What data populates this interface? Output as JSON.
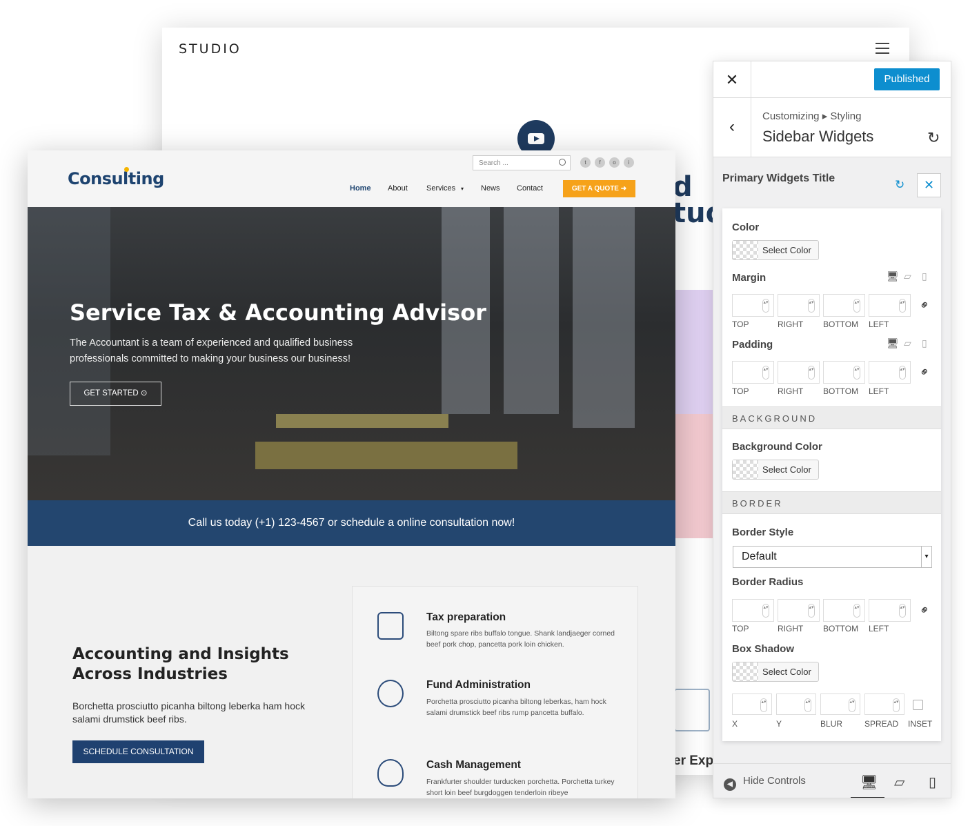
{
  "studio": {
    "logo": "STUDIO",
    "heading_fragment_1": "d",
    "heading_fragment_2": "tud",
    "footer_fragment": "er Exp"
  },
  "site": {
    "logo": "Consulting",
    "search_placeholder": "Search ...",
    "social": [
      "t",
      "f",
      "o",
      "i"
    ],
    "nav": [
      "Home",
      "About",
      "Services",
      "News",
      "Contact"
    ],
    "quote_button": "GET A QUOTE",
    "hero": {
      "title": "Service Tax & Accounting Advisor",
      "text": "The Accountant is a team of experienced and qualified business professionals committed to making your business our business!",
      "button": "GET STARTED"
    },
    "callbar": "Call us today (+1) 123-4567 or schedule a online consultation now!",
    "about": {
      "title": "Accounting and Insights Across Industries",
      "body": "Borchetta prosciutto picanha biltong leberka ham hock salami drumstick beef ribs.",
      "button": "SCHEDULE CONSULTATION"
    },
    "services": [
      {
        "title": "Tax preparation",
        "desc": "Biltong spare ribs buffalo tongue. Shank landjaeger corned beef pork chop, pancetta pork loin chicken.",
        "icon": "tax-document-icon"
      },
      {
        "title": "Fund Administration",
        "desc": "Porchetta prosciutto picanha biltong leberkas, ham hock salami drumstick beef ribs rump pancetta buffalo.",
        "icon": "fund-cycle-icon"
      },
      {
        "title": "Cash Management",
        "desc": "Frankfurter shoulder turducken porchetta. Porchetta turkey short loin beef burgdoggen tenderloin ribeye",
        "icon": "piggy-bank-icon"
      }
    ],
    "colors": {
      "brand": "#1e4470",
      "accent": "#f6a21a",
      "callbar": "#23466f"
    }
  },
  "panel": {
    "status_button": "Published",
    "breadcrumb": "Customizing ▸ Styling",
    "title": "Sidebar Widgets",
    "section_title": "Primary Widgets Title",
    "color_label": "Color",
    "select_color": "Select Color",
    "margin_label": "Margin",
    "padding_label": "Padding",
    "sides": [
      "TOP",
      "RIGHT",
      "BOTTOM",
      "LEFT"
    ],
    "background_section": "BACKGROUND",
    "background_color_label": "Background Color",
    "border_section": "BORDER",
    "border_style_label": "Border Style",
    "border_style_value": "Default",
    "border_radius_label": "Border Radius",
    "box_shadow_label": "Box Shadow",
    "shadow_fields": [
      "X",
      "Y",
      "BLUR",
      "SPREAD",
      "INSET"
    ],
    "hide_controls": "Hide Controls",
    "accent": "#0d8ecf"
  }
}
